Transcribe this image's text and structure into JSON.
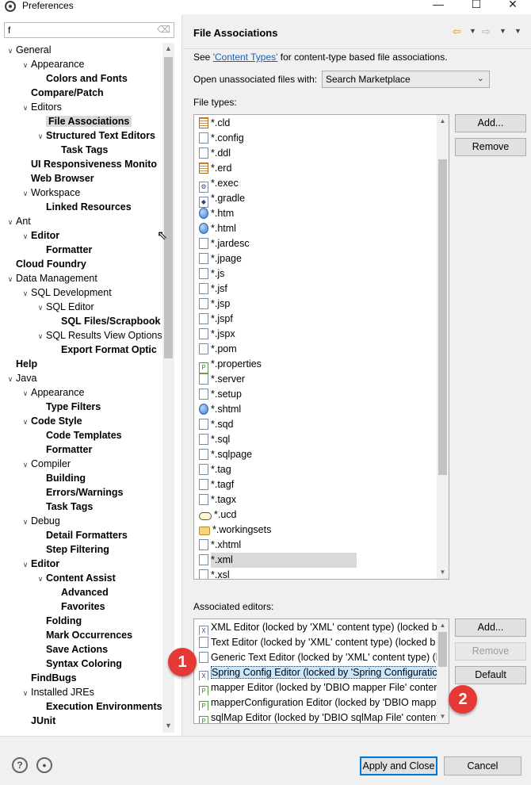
{
  "window": {
    "title": "Preferences",
    "minimize": "—",
    "maximize": "☐",
    "close": "✕"
  },
  "filter": {
    "value": "f",
    "clear": "⌫"
  },
  "tree": [
    {
      "label": "General",
      "level": 0,
      "arrow": "open",
      "bold": false
    },
    {
      "label": "Appearance",
      "level": 1,
      "arrow": "open",
      "bold": false
    },
    {
      "label": "Colors and Fonts",
      "level": 2,
      "arrow": "none",
      "bold": true
    },
    {
      "label": "Compare/Patch",
      "level": 1,
      "arrow": "none",
      "bold": true
    },
    {
      "label": "Editors",
      "level": 1,
      "arrow": "open",
      "bold": false
    },
    {
      "label": "File Associations",
      "level": 2,
      "arrow": "none",
      "bold": true,
      "selected": true
    },
    {
      "label": "Structured Text Editors",
      "level": 2,
      "arrow": "open",
      "bold": true
    },
    {
      "label": "Task Tags",
      "level": 3,
      "arrow": "none",
      "bold": true
    },
    {
      "label": "UI Responsiveness Monito",
      "level": 1,
      "arrow": "none",
      "bold": true
    },
    {
      "label": "Web Browser",
      "level": 1,
      "arrow": "none",
      "bold": true
    },
    {
      "label": "Workspace",
      "level": 1,
      "arrow": "open",
      "bold": false
    },
    {
      "label": "Linked Resources",
      "level": 2,
      "arrow": "none",
      "bold": true
    },
    {
      "label": "Ant",
      "level": 0,
      "arrow": "open",
      "bold": false
    },
    {
      "label": "Editor",
      "level": 1,
      "arrow": "open",
      "bold": true
    },
    {
      "label": "Formatter",
      "level": 2,
      "arrow": "none",
      "bold": true
    },
    {
      "label": "Cloud Foundry",
      "level": 0,
      "arrow": "none",
      "bold": true
    },
    {
      "label": "Data Management",
      "level": 0,
      "arrow": "open",
      "bold": false
    },
    {
      "label": "SQL Development",
      "level": 1,
      "arrow": "open",
      "bold": false
    },
    {
      "label": "SQL Editor",
      "level": 2,
      "arrow": "open",
      "bold": false
    },
    {
      "label": "SQL Files/Scrapbook",
      "level": 3,
      "arrow": "none",
      "bold": true
    },
    {
      "label": "SQL Results View Options",
      "level": 2,
      "arrow": "open",
      "bold": false
    },
    {
      "label": "Export Format Optic",
      "level": 3,
      "arrow": "none",
      "bold": true
    },
    {
      "label": "Help",
      "level": 0,
      "arrow": "none",
      "bold": true
    },
    {
      "label": "Java",
      "level": 0,
      "arrow": "open",
      "bold": false
    },
    {
      "label": "Appearance",
      "level": 1,
      "arrow": "open",
      "bold": false
    },
    {
      "label": "Type Filters",
      "level": 2,
      "arrow": "none",
      "bold": true
    },
    {
      "label": "Code Style",
      "level": 1,
      "arrow": "open",
      "bold": true
    },
    {
      "label": "Code Templates",
      "level": 2,
      "arrow": "none",
      "bold": true
    },
    {
      "label": "Formatter",
      "level": 2,
      "arrow": "none",
      "bold": true
    },
    {
      "label": "Compiler",
      "level": 1,
      "arrow": "open",
      "bold": false
    },
    {
      "label": "Building",
      "level": 2,
      "arrow": "none",
      "bold": true
    },
    {
      "label": "Errors/Warnings",
      "level": 2,
      "arrow": "none",
      "bold": true
    },
    {
      "label": "Task Tags",
      "level": 2,
      "arrow": "none",
      "bold": true
    },
    {
      "label": "Debug",
      "level": 1,
      "arrow": "open",
      "bold": false
    },
    {
      "label": "Detail Formatters",
      "level": 2,
      "arrow": "none",
      "bold": true
    },
    {
      "label": "Step Filtering",
      "level": 2,
      "arrow": "none",
      "bold": true
    },
    {
      "label": "Editor",
      "level": 1,
      "arrow": "open",
      "bold": true
    },
    {
      "label": "Content Assist",
      "level": 2,
      "arrow": "open",
      "bold": true
    },
    {
      "label": "Advanced",
      "level": 3,
      "arrow": "none",
      "bold": true
    },
    {
      "label": "Favorites",
      "level": 3,
      "arrow": "none",
      "bold": true
    },
    {
      "label": "Folding",
      "level": 2,
      "arrow": "none",
      "bold": true
    },
    {
      "label": "Mark Occurrences",
      "level": 2,
      "arrow": "none",
      "bold": true
    },
    {
      "label": "Save Actions",
      "level": 2,
      "arrow": "none",
      "bold": true
    },
    {
      "label": "Syntax Coloring",
      "level": 2,
      "arrow": "none",
      "bold": true
    },
    {
      "label": "FindBugs",
      "level": 1,
      "arrow": "none",
      "bold": true
    },
    {
      "label": "Installed JREs",
      "level": 1,
      "arrow": "open",
      "bold": false
    },
    {
      "label": "Execution Environments",
      "level": 2,
      "arrow": "none",
      "bold": true
    },
    {
      "label": "JUnit",
      "level": 1,
      "arrow": "none",
      "bold": true
    }
  ],
  "page": {
    "title": "File Associations",
    "desc_prefix": "See ",
    "desc_link": "'Content Types'",
    "desc_suffix": " for content-type based file associations.",
    "open_label": "Open unassociated files with:",
    "open_value": "Search Marketplace",
    "file_types_label": "File types:",
    "editors_label": "Associated editors:"
  },
  "file_types": [
    {
      "name": "*.cld",
      "icon": "grid"
    },
    {
      "name": "*.config",
      "icon": "doc"
    },
    {
      "name": "*.ddl",
      "icon": "doc"
    },
    {
      "name": "*.erd",
      "icon": "grid"
    },
    {
      "name": "*.exec",
      "icon": "gear"
    },
    {
      "name": "*.gradle",
      "icon": "elephant"
    },
    {
      "name": "*.htm",
      "icon": "globe"
    },
    {
      "name": "*.html",
      "icon": "globe"
    },
    {
      "name": "*.jardesc",
      "icon": "doc"
    },
    {
      "name": "*.jpage",
      "icon": "doc"
    },
    {
      "name": "*.js",
      "icon": "doc"
    },
    {
      "name": "*.jsf",
      "icon": "doc"
    },
    {
      "name": "*.jsp",
      "icon": "doc"
    },
    {
      "name": "*.jspf",
      "icon": "doc"
    },
    {
      "name": "*.jspx",
      "icon": "doc"
    },
    {
      "name": "*.pom",
      "icon": "doc"
    },
    {
      "name": "*.properties",
      "icon": "green"
    },
    {
      "name": "*.server",
      "icon": "doc"
    },
    {
      "name": "*.setup",
      "icon": "doc"
    },
    {
      "name": "*.shtml",
      "icon": "globe"
    },
    {
      "name": "*.sqd",
      "icon": "doc"
    },
    {
      "name": "*.sql",
      "icon": "doc"
    },
    {
      "name": "*.sqlpage",
      "icon": "doc"
    },
    {
      "name": "*.tag",
      "icon": "doc"
    },
    {
      "name": "*.tagf",
      "icon": "doc"
    },
    {
      "name": "*.tagx",
      "icon": "doc"
    },
    {
      "name": "*.ucd",
      "icon": "oval"
    },
    {
      "name": "*.workingsets",
      "icon": "folder"
    },
    {
      "name": "*.xhtml",
      "icon": "doc"
    },
    {
      "name": "*.xml",
      "icon": "doc",
      "selected": true
    },
    {
      "name": "*.xsl",
      "icon": "doc"
    }
  ],
  "editors": [
    {
      "name": "XML Editor (locked by 'XML' content type) (locked b",
      "icon": "x"
    },
    {
      "name": "Text Editor (locked by 'XML' content type) (locked b",
      "icon": "doc"
    },
    {
      "name": "Generic Text Editor (locked by 'XML' content type) (l",
      "icon": "doc"
    },
    {
      "name": "Spring Config Editor (locked by 'Spring Configuratic",
      "icon": "x",
      "highlight": true
    },
    {
      "name": "mapper Editor (locked by 'DBIO mapper File' conten",
      "icon": "green"
    },
    {
      "name": "mapperConfiguration Editor (locked by 'DBIO mappe",
      "icon": "green"
    },
    {
      "name": "sqlMap Editor (locked by 'DBIO sqlMap File' content",
      "icon": "green"
    }
  ],
  "buttons": {
    "types_add": "Add...",
    "types_remove": "Remove",
    "editors_add": "Add...",
    "editors_remove": "Remove",
    "editors_default": "Default",
    "apply_close": "Apply and Close",
    "cancel": "Cancel"
  },
  "bottom_icons": {
    "help": "?",
    "record": "●"
  },
  "annotations": {
    "badge1": "1",
    "badge2": "2"
  },
  "colors": {
    "badge": "#e53935",
    "link": "#1a5fb4",
    "selection": "#d9d9d9"
  }
}
